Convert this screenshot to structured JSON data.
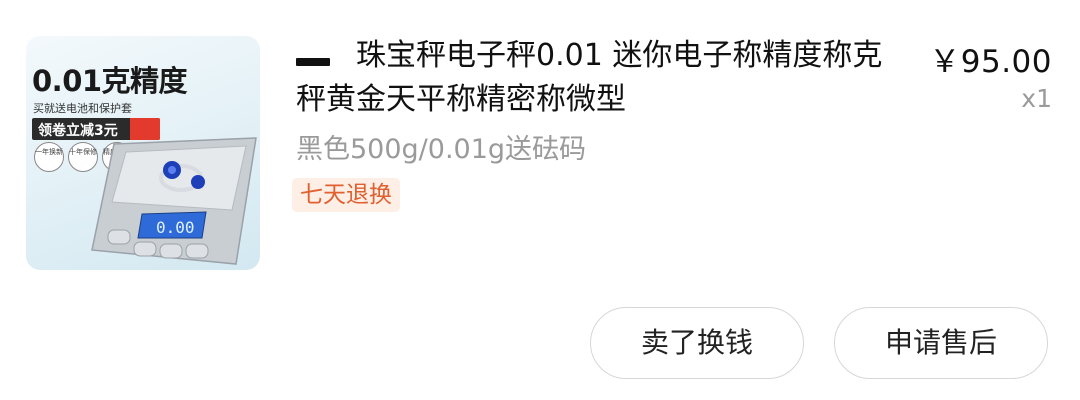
{
  "product": {
    "title": "珠宝秤电子秤0.01 迷你电子称精度称克秤黄金天平称精密称微型",
    "price": "￥95.00",
    "quantity": "x1",
    "variant": "黑色500g/0.01g送砝码",
    "service_tag": "七天退换",
    "thumbnail": {
      "promo_title": "0.01克精度",
      "promo_sub": "买就送电池和保护套",
      "coupon": "领卷立减3元",
      "perks": [
        "一年换新",
        "十年保修",
        "精度利用"
      ],
      "display_value": "0.00"
    }
  },
  "actions": {
    "sell_label": "卖了换钱",
    "aftersale_label": "申请售后"
  },
  "colors": {
    "tag_text": "#e0602f",
    "tag_bg": "#fdeee6",
    "muted_text": "#9a9a9a",
    "button_border": "#d7d7d7"
  }
}
